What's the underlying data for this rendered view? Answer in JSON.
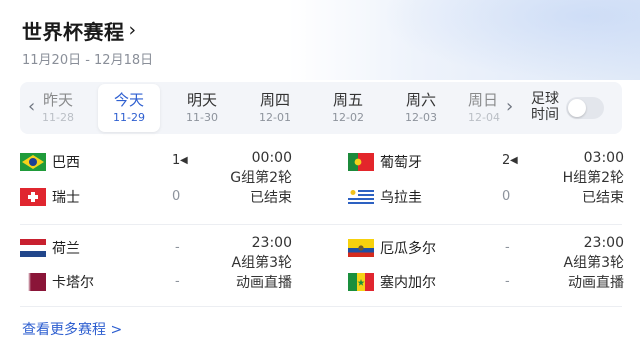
{
  "header": {
    "title": "世界杯赛程",
    "chevron": "›",
    "date_range": "11月20日 - 12月18日"
  },
  "day_strip": {
    "prev_arrow": "‹",
    "next_arrow": "›",
    "days": [
      {
        "label": "昨天",
        "date": "11-28",
        "state": "faded-left"
      },
      {
        "label": "今天",
        "date": "11-29",
        "state": "active"
      },
      {
        "label": "明天",
        "date": "11-30",
        "state": "normal"
      },
      {
        "label": "周四",
        "date": "12-01",
        "state": "normal"
      },
      {
        "label": "周五",
        "date": "12-02",
        "state": "normal"
      },
      {
        "label": "周六",
        "date": "12-03",
        "state": "normal"
      },
      {
        "label": "周日",
        "date": "12-04",
        "state": "faded-right"
      }
    ],
    "toggle_label": "足球\n时间",
    "toggle_on": false
  },
  "matches": [
    {
      "home": {
        "name": "巴西",
        "flag": "brazil",
        "score": "1"
      },
      "away": {
        "name": "瑞士",
        "flag": "switzerland",
        "score": "0"
      },
      "time": "00:00",
      "round": "G组第2轮",
      "status": "已结束"
    },
    {
      "home": {
        "name": "葡萄牙",
        "flag": "portugal",
        "score": "2"
      },
      "away": {
        "name": "乌拉圭",
        "flag": "uruguay",
        "score": "0"
      },
      "time": "03:00",
      "round": "H组第2轮",
      "status": "已结束"
    },
    {
      "home": {
        "name": "荷兰",
        "flag": "netherlands",
        "score": "-"
      },
      "away": {
        "name": "卡塔尔",
        "flag": "qatar",
        "score": "-"
      },
      "time": "23:00",
      "round": "A组第3轮",
      "status": "动画直播"
    },
    {
      "home": {
        "name": "厄瓜多尔",
        "flag": "ecuador",
        "score": "-"
      },
      "away": {
        "name": "塞内加尔",
        "flag": "senegal",
        "score": "-"
      },
      "time": "23:00",
      "round": "A组第3轮",
      "status": "动画直播"
    }
  ],
  "footer": {
    "more_link": "查看更多赛程 >"
  }
}
